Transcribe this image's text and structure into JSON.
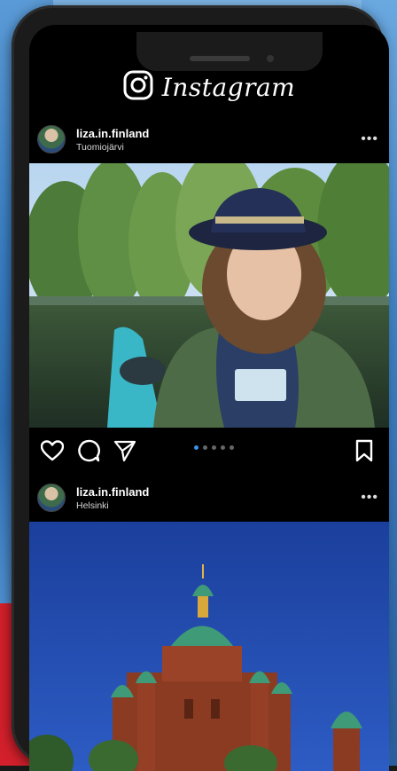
{
  "app": {
    "name": "Instagram"
  },
  "posts": [
    {
      "username": "liza.in.finland",
      "location": "Tuomiojärvi",
      "carousel_total": 5,
      "carousel_index": 1
    },
    {
      "username": "liza.in.finland",
      "location": "Helsinki"
    }
  ],
  "icons": {
    "logo": "instagram-icon",
    "like": "heart-icon",
    "comment": "comment-icon",
    "share": "send-icon",
    "save": "bookmark-icon",
    "more": "more-horizontal-icon"
  },
  "colors": {
    "background": "#000000",
    "accent_dot": "#3d8fe8"
  }
}
